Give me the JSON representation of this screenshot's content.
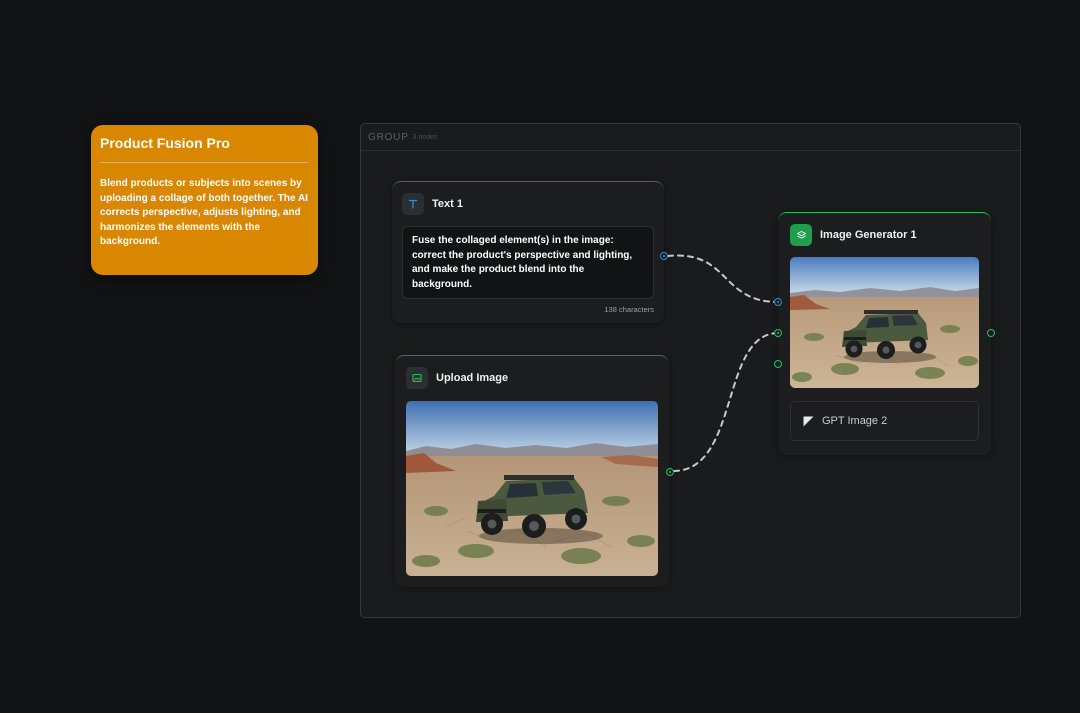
{
  "note": {
    "title": "Product Fusion Pro",
    "body": "Blend products or subjects into scenes by uploading a collage of both together. The AI corrects perspective, adjusts lighting, and harmonizes the elements with the background."
  },
  "group": {
    "label": "GROUP",
    "count": "3 nodes"
  },
  "text_node": {
    "title": "Text 1",
    "content": "Fuse the collaged element(s) in the image: correct the product's perspective and lighting, and make the product blend into the background.",
    "char_count": "138 characters",
    "icon": "text-icon"
  },
  "upload_node": {
    "title": "Upload Image",
    "icon": "image-icon",
    "image": "offroad-vehicle-in-desert"
  },
  "generator_node": {
    "title": "Image Generator 1",
    "icon": "layers-icon",
    "image": "offroad-vehicle-in-desert",
    "model": "GPT Image 2",
    "model_icon": "openai-model-icon"
  },
  "colors": {
    "canvas": "#121314",
    "note": "#d98700",
    "text_port": "#2b8fd1",
    "image_port": "#22c05a",
    "edge": "#c8c8c8"
  }
}
